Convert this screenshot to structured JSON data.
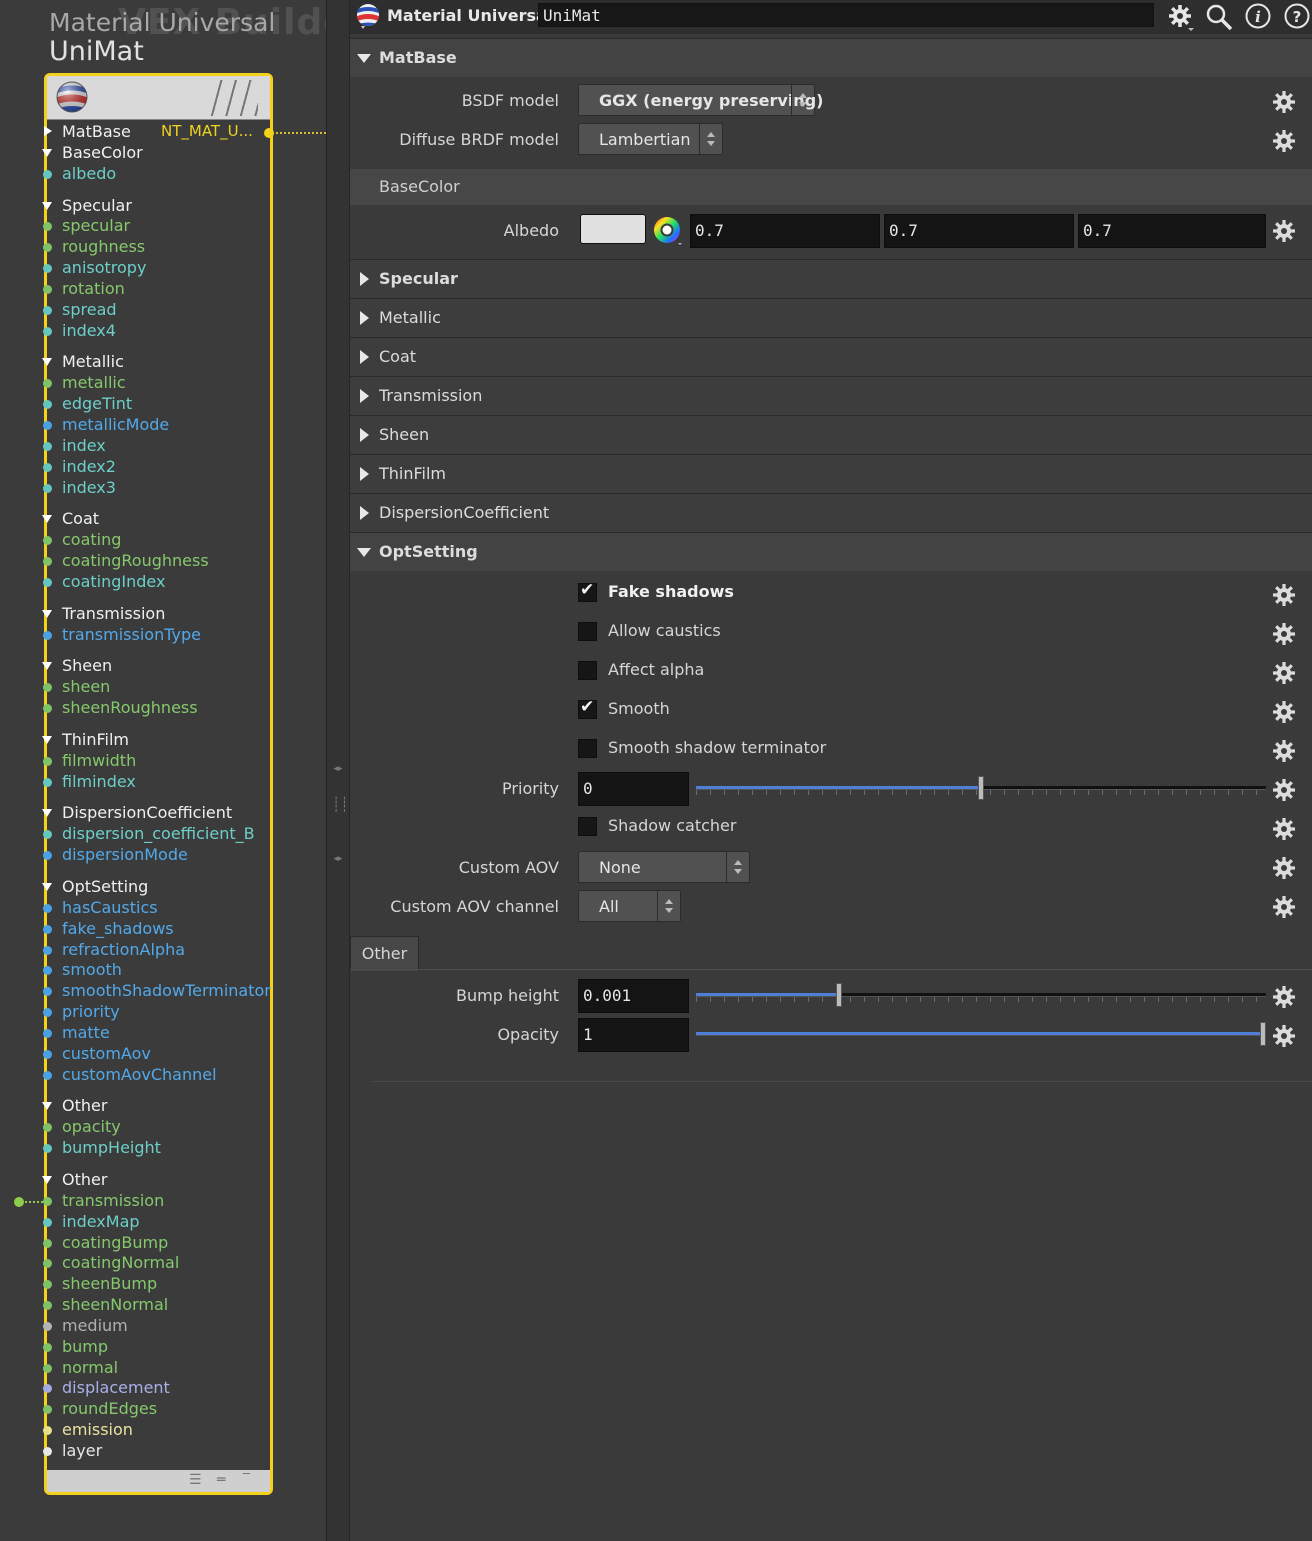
{
  "network": {
    "title_line1": "Material Universal",
    "title_line2": "UniMat",
    "watermark": "VEX Builder",
    "output_label": "NT_MAT_U..."
  },
  "ports": [
    {
      "label": "MatBase",
      "kind": "group",
      "collapsed": true
    },
    {
      "label": "BaseColor",
      "kind": "group"
    },
    {
      "label": "albedo",
      "kind": "color"
    },
    {
      "kind": "gap"
    },
    {
      "label": "Specular",
      "kind": "group"
    },
    {
      "label": "specular",
      "kind": "float"
    },
    {
      "label": "roughness",
      "kind": "float"
    },
    {
      "label": "anisotropy",
      "kind": "color"
    },
    {
      "label": "rotation",
      "kind": "float"
    },
    {
      "label": "spread",
      "kind": "color"
    },
    {
      "label": "index4",
      "kind": "color"
    },
    {
      "kind": "gap"
    },
    {
      "label": "Metallic",
      "kind": "group"
    },
    {
      "label": "metallic",
      "kind": "float"
    },
    {
      "label": "edgeTint",
      "kind": "color"
    },
    {
      "label": "metallicMode",
      "kind": "int"
    },
    {
      "label": "index",
      "kind": "color"
    },
    {
      "label": "index2",
      "kind": "color"
    },
    {
      "label": "index3",
      "kind": "color"
    },
    {
      "kind": "gap"
    },
    {
      "label": "Coat",
      "kind": "group"
    },
    {
      "label": "coating",
      "kind": "float"
    },
    {
      "label": "coatingRoughness",
      "kind": "float"
    },
    {
      "label": "coatingIndex",
      "kind": "color"
    },
    {
      "kind": "gap"
    },
    {
      "label": "Transmission",
      "kind": "group"
    },
    {
      "label": "transmissionType",
      "kind": "int"
    },
    {
      "kind": "gap"
    },
    {
      "label": "Sheen",
      "kind": "group"
    },
    {
      "label": "sheen",
      "kind": "float"
    },
    {
      "label": "sheenRoughness",
      "kind": "float"
    },
    {
      "kind": "gap"
    },
    {
      "label": "ThinFilm",
      "kind": "group"
    },
    {
      "label": "filmwidth",
      "kind": "float"
    },
    {
      "label": "filmindex",
      "kind": "color"
    },
    {
      "kind": "gap"
    },
    {
      "label": "DispersionCoefficient",
      "kind": "group"
    },
    {
      "label": "dispersion_coefficient_B",
      "kind": "color"
    },
    {
      "label": "dispersionMode",
      "kind": "int"
    },
    {
      "kind": "gap"
    },
    {
      "label": "OptSetting",
      "kind": "group"
    },
    {
      "label": "hasCaustics",
      "kind": "int"
    },
    {
      "label": "fake_shadows",
      "kind": "int"
    },
    {
      "label": "refractionAlpha",
      "kind": "int"
    },
    {
      "label": "smooth",
      "kind": "int"
    },
    {
      "label": "smoothShadowTerminator",
      "kind": "int"
    },
    {
      "label": "priority",
      "kind": "int"
    },
    {
      "label": "matte",
      "kind": "int"
    },
    {
      "label": "customAov",
      "kind": "int"
    },
    {
      "label": "customAovChannel",
      "kind": "int"
    },
    {
      "kind": "gap"
    },
    {
      "label": "Other",
      "kind": "group"
    },
    {
      "label": "opacity",
      "kind": "float"
    },
    {
      "label": "bumpHeight",
      "kind": "color"
    },
    {
      "kind": "gap"
    },
    {
      "label": "Other",
      "kind": "group"
    },
    {
      "label": "transmission",
      "kind": "float"
    },
    {
      "label": "indexMap",
      "kind": "color"
    },
    {
      "label": "coatingBump",
      "kind": "float"
    },
    {
      "label": "coatingNormal",
      "kind": "float"
    },
    {
      "label": "sheenBump",
      "kind": "float"
    },
    {
      "label": "sheenNormal",
      "kind": "float"
    },
    {
      "label": "medium",
      "kind": "grey"
    },
    {
      "label": "bump",
      "kind": "float"
    },
    {
      "label": "normal",
      "kind": "float"
    },
    {
      "label": "displacement",
      "kind": "vec"
    },
    {
      "label": "roundEdges",
      "kind": "float"
    },
    {
      "label": "emission",
      "kind": "yel"
    },
    {
      "label": "layer",
      "kind": "white"
    }
  ],
  "params": {
    "node_type": "Material Universal",
    "node_name": "UniMat",
    "sections": {
      "matbase": "MatBase",
      "basecolor": "BaseColor",
      "specular": "Specular",
      "metallic": "Metallic",
      "coat": "Coat",
      "transmission": "Transmission",
      "sheen": "Sheen",
      "thinfilm": "ThinFilm",
      "dispersion": "DispersionCoefficient",
      "optsetting": "OptSetting",
      "other": "Other"
    },
    "bsdf_label": "BSDF model",
    "bsdf_value": "GGX (energy preserving)",
    "diffuse_label": "Diffuse BRDF model",
    "diffuse_value": "Lambertian",
    "albedo_label": "Albedo",
    "albedo_r": "0.7",
    "albedo_g": "0.7",
    "albedo_b": "0.7",
    "fake_shadows": "Fake shadows",
    "allow_caustics": "Allow caustics",
    "affect_alpha": "Affect alpha",
    "smooth": "Smooth",
    "smooth_shadow_terminator": "Smooth shadow terminator",
    "priority_label": "Priority",
    "priority_value": "0",
    "priority_slider": 0.5,
    "shadow_catcher": "Shadow catcher",
    "custom_aov_label": "Custom AOV",
    "custom_aov_value": "None",
    "custom_aov_channel_label": "Custom AOV channel",
    "custom_aov_channel_value": "All",
    "bump_height_label": "Bump height",
    "bump_height_value": "0.001",
    "bump_height_slider": 0.25,
    "opacity_label": "Opacity",
    "opacity_value": "1",
    "opacity_slider": 1.0
  },
  "colors": {
    "node_border": "#f5d21a",
    "slider_fill": "#4f7ed6"
  },
  "icons": [
    "gear-icon",
    "search-icon",
    "info-icon",
    "help-icon",
    "material-ball-icon",
    "color-wheel-icon"
  ]
}
